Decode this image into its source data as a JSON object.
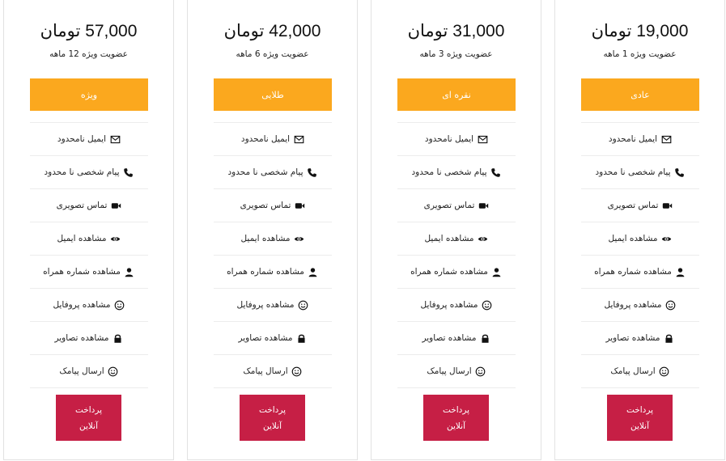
{
  "plans": [
    {
      "price": "57,000 تومان",
      "subtitle": "عضویت ویژه 12 ماهه",
      "type": "ویژه"
    },
    {
      "price": "42,000 تومان",
      "subtitle": "عضویت ویژه 6 ماهه",
      "type": "طلایی"
    },
    {
      "price": "31,000 تومان",
      "subtitle": "عضویت ویژه 3 ماهه",
      "type": "نقره ای"
    },
    {
      "price": "19,000 تومان",
      "subtitle": "عضویت ویژه 1 ماهه",
      "type": "عادی"
    }
  ],
  "features": [
    {
      "label": "ایمیل نامحدود",
      "icon": "envelope-icon"
    },
    {
      "label": "پیام شخصی نا محدود",
      "icon": "phone-icon"
    },
    {
      "label": "تماس تصویری",
      "icon": "video-camera-icon"
    },
    {
      "label": "مشاهده ایمیل",
      "icon": "eye-icon"
    },
    {
      "label": "مشاهده شماره همراه",
      "icon": "user-icon"
    },
    {
      "label": "مشاهده پروفایل",
      "icon": "smile-icon"
    },
    {
      "label": "مشاهده تصاویر",
      "icon": "lock-icon"
    },
    {
      "label": "ارسال پیامک",
      "icon": "smile-icon"
    }
  ],
  "pay_button": {
    "line1": "پرداخت",
    "line2": "آنلاین"
  },
  "colors": {
    "type_button": "#fba81e",
    "pay_button": "#c61f45"
  }
}
